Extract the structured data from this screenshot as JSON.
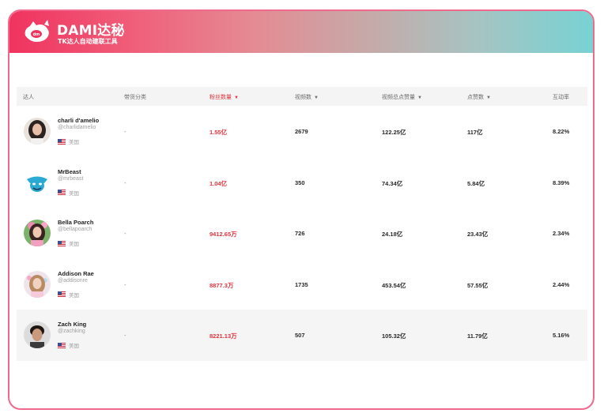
{
  "brand": {
    "name": "DAMI达秘",
    "tagline": "TK达人自动建联工具",
    "colors": {
      "accent_pink": "#f0335f",
      "accent_teal": "#78d2d4",
      "highlight_red": "#e0343f"
    }
  },
  "table": {
    "columns": [
      {
        "label": "达人",
        "sortable": false,
        "active": false
      },
      {
        "label": "带货分类",
        "sortable": false,
        "active": false
      },
      {
        "label": "粉丝数量",
        "sortable": true,
        "active": true
      },
      {
        "label": "视频数",
        "sortable": true,
        "active": false
      },
      {
        "label": "视频总点赞量",
        "sortable": true,
        "active": false
      },
      {
        "label": "点赞数",
        "sortable": true,
        "active": false
      },
      {
        "label": "互动率",
        "sortable": false,
        "active": false
      }
    ],
    "sort_glyph": "▼",
    "rows": [
      {
        "name": "charli d'amelio",
        "handle": "@charlidamelio",
        "region": "美国",
        "category": "-",
        "followers": "1.55亿",
        "videos": "2679",
        "total_likes": "122.25亿",
        "likes": "117亿",
        "engagement": "8.22%",
        "avatar": "woman-dark-hair"
      },
      {
        "name": "MrBeast",
        "handle": "@mrbeast",
        "region": "美国",
        "category": "-",
        "followers": "1.04亿",
        "videos": "350",
        "total_likes": "74.34亿",
        "likes": "5.84亿",
        "engagement": "8.39%",
        "avatar": "mrbeast-logo"
      },
      {
        "name": "Bella Poarch",
        "handle": "@bellapoarch",
        "region": "美国",
        "category": "-",
        "followers": "9412.65万",
        "videos": "726",
        "total_likes": "24.18亿",
        "likes": "23.43亿",
        "engagement": "2.34%",
        "avatar": "woman-pink"
      },
      {
        "name": "Addison Rae",
        "handle": "@addisonre",
        "region": "美国",
        "category": "-",
        "followers": "8877.3万",
        "videos": "1735",
        "total_likes": "453.54亿",
        "likes": "57.55亿",
        "engagement": "2.44%",
        "avatar": "woman-light"
      },
      {
        "name": "Zach King",
        "handle": "@zachking",
        "region": "美国",
        "category": "-",
        "followers": "8221.13万",
        "videos": "507",
        "total_likes": "105.32亿",
        "likes": "11.79亿",
        "engagement": "5.16%",
        "avatar": "man-dark-hair"
      }
    ]
  }
}
